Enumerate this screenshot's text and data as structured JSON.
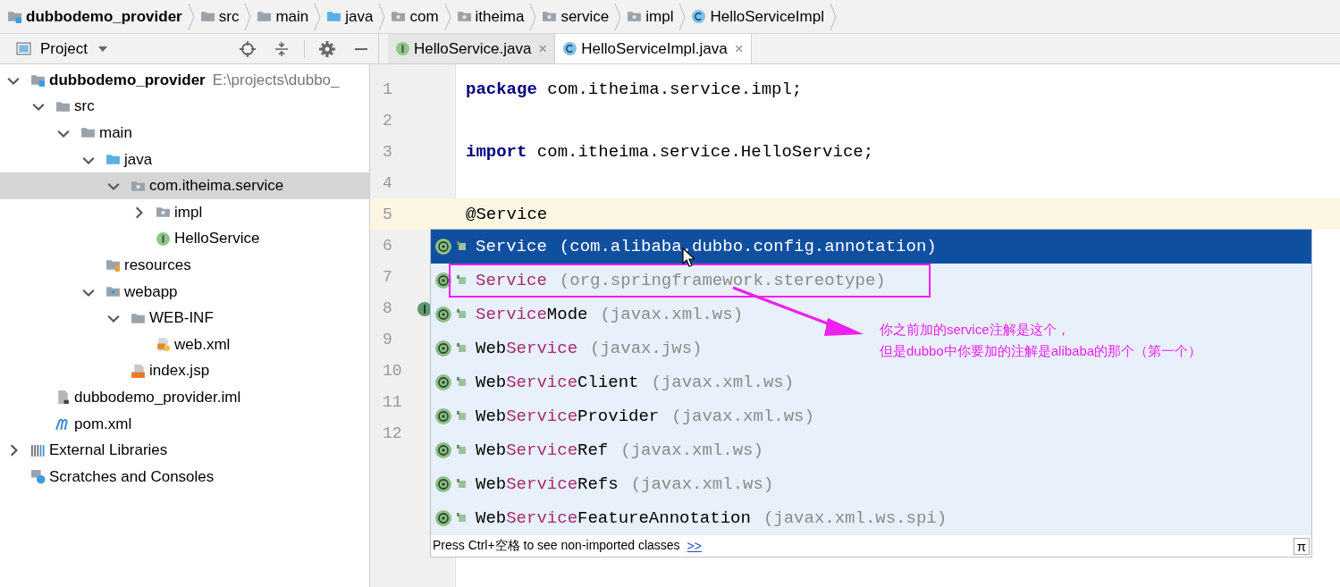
{
  "breadcrumbs": [
    {
      "label": "dubbodemo_provider",
      "kind": "module"
    },
    {
      "label": "src",
      "kind": "folder"
    },
    {
      "label": "main",
      "kind": "folder"
    },
    {
      "label": "java",
      "kind": "source"
    },
    {
      "label": "com",
      "kind": "package"
    },
    {
      "label": "itheima",
      "kind": "package"
    },
    {
      "label": "service",
      "kind": "package"
    },
    {
      "label": "impl",
      "kind": "package"
    },
    {
      "label": "HelloServiceImpl",
      "kind": "class"
    }
  ],
  "project_panel": {
    "title": "Project"
  },
  "tabs": [
    {
      "label": "HelloService.java",
      "kind": "interface",
      "close": "×",
      "selected": false
    },
    {
      "label": "HelloServiceImpl.java",
      "kind": "class",
      "close": "×",
      "selected": true
    }
  ],
  "tree": [
    {
      "label": "dubbodemo_provider",
      "path": "E:\\projects\\dubbo_",
      "kind": "module",
      "expanded": true,
      "selected": false,
      "children": [
        {
          "label": "src",
          "kind": "folder",
          "expanded": true,
          "selected": false,
          "children": [
            {
              "label": "main",
              "kind": "folder",
              "expanded": true,
              "selected": false,
              "children": [
                {
                  "label": "java",
                  "kind": "source",
                  "expanded": true,
                  "selected": false,
                  "children": [
                    {
                      "label": "com.itheima.service",
                      "kind": "package",
                      "expanded": true,
                      "selected": true,
                      "children": [
                        {
                          "label": "impl",
                          "kind": "package",
                          "expanded": false,
                          "selected": false
                        },
                        {
                          "label": "HelloService",
                          "kind": "interface",
                          "selected": false
                        }
                      ]
                    }
                  ]
                },
                {
                  "label": "resources",
                  "kind": "resources",
                  "selected": false
                },
                {
                  "label": "webapp",
                  "kind": "web",
                  "expanded": true,
                  "selected": false,
                  "children": [
                    {
                      "label": "WEB-INF",
                      "kind": "folder",
                      "expanded": true,
                      "selected": false,
                      "children": [
                        {
                          "label": "web.xml",
                          "kind": "xml",
                          "selected": false
                        }
                      ]
                    },
                    {
                      "label": "index.jsp",
                      "kind": "jsp",
                      "selected": false
                    }
                  ]
                }
              ]
            }
          ]
        },
        {
          "label": "dubbodemo_provider.iml",
          "kind": "iml",
          "selected": false
        },
        {
          "label": "pom.xml",
          "kind": "maven",
          "selected": false
        }
      ]
    },
    {
      "label": "External Libraries",
      "kind": "libraries",
      "expanded": false,
      "selected": false
    },
    {
      "label": "Scratches and Consoles",
      "kind": "scratches",
      "selected": false
    }
  ],
  "editor": {
    "lines": [
      {
        "number": "1",
        "code": [
          {
            "kind": "keyword",
            "text": "package"
          },
          {
            "kind": "plain",
            "text": " com.itheima.service.impl;"
          }
        ]
      },
      {
        "number": "2"
      },
      {
        "number": "3",
        "code": [
          {
            "kind": "keyword",
            "text": "import"
          },
          {
            "kind": "plain",
            "text": " com.itheima.service.HelloService;"
          }
        ]
      },
      {
        "number": "4"
      },
      {
        "number": "5",
        "current": true,
        "code": [
          {
            "kind": "plain",
            "text": "@Service"
          }
        ]
      },
      {
        "number": "6"
      },
      {
        "number": "7"
      },
      {
        "number": "8",
        "implemented": true
      },
      {
        "number": "9"
      },
      {
        "number": "10"
      },
      {
        "number": "11"
      },
      {
        "number": "12"
      }
    ]
  },
  "completion": {
    "items": [
      {
        "match": "Service",
        "package": "(com.alibaba.dubbo.config.annotation)",
        "selected": true,
        "boxed": false
      },
      {
        "match": "Service",
        "package": "(org.springframework.stereotype)",
        "selected": false,
        "boxed": true
      },
      {
        "match": "Service",
        "suffix": "Mode",
        "package": "(javax.xml.ws)",
        "selected": false,
        "boxed": false
      },
      {
        "prefix": "Web",
        "match": "Service",
        "package": "(javax.jws)",
        "selected": false,
        "boxed": false
      },
      {
        "prefix": "Web",
        "match": "Service",
        "suffix": "Client",
        "package": "(javax.xml.ws)",
        "selected": false,
        "boxed": false
      },
      {
        "prefix": "Web",
        "match": "Service",
        "suffix": "Provider",
        "package": "(javax.xml.ws)",
        "selected": false,
        "boxed": false
      },
      {
        "prefix": "Web",
        "match": "Service",
        "suffix": "Ref",
        "package": "(javax.xml.ws)",
        "selected": false,
        "boxed": false
      },
      {
        "prefix": "Web",
        "match": "Service",
        "suffix": "Refs",
        "package": "(javax.xml.ws)",
        "selected": false,
        "boxed": false
      },
      {
        "prefix": "Web",
        "match": "Service",
        "suffix": "FeatureAnnotation",
        "package": "(javax.xml.ws.spi)",
        "selected": false,
        "boxed": false
      }
    ],
    "hint": "Press Ctrl+空格 to see non-imported classes",
    "link": ">>",
    "corner": "π"
  },
  "callout": {
    "lines": [
      "你之前加的service注解是这个，",
      "但是dubbo中你要加的注解是alibaba的那个（第一个）"
    ]
  }
}
